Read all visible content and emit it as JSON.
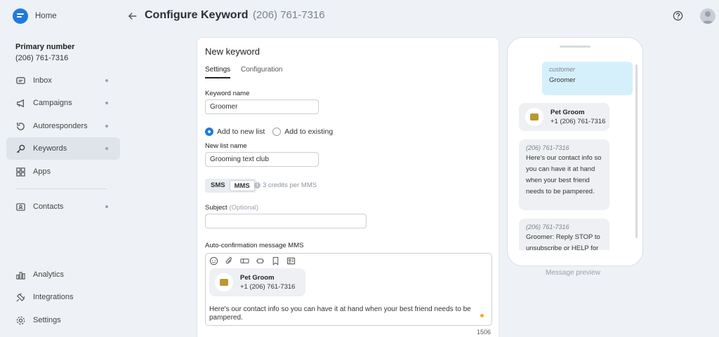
{
  "sidebar": {
    "home_label": "Home",
    "primary_title": "Primary number",
    "primary_number": "(206) 761-7316",
    "items": [
      {
        "label": "Inbox"
      },
      {
        "label": "Campaigns"
      },
      {
        "label": "Autoresponders"
      },
      {
        "label": "Keywords"
      },
      {
        "label": "Apps"
      },
      {
        "label": "Contacts"
      },
      {
        "label": "Analytics"
      },
      {
        "label": "Integrations"
      },
      {
        "label": "Settings"
      }
    ]
  },
  "header": {
    "title": "Configure Keyword",
    "phone": "(206) 761-7316"
  },
  "form": {
    "card_title": "New keyword",
    "tabs": [
      {
        "label": "Settings"
      },
      {
        "label": "Configuration"
      }
    ],
    "keyword_label": "Keyword name",
    "keyword_value": "Groomer",
    "radio_new": "Add to new list",
    "radio_existing": "Add to existing",
    "list_label": "New list name",
    "list_value": "Grooming text club",
    "seg_sms": "SMS",
    "seg_mms": "MMS",
    "credits": "3 credits per MMS",
    "subject_label": "Subject",
    "subject_optional": "(Optional)",
    "subject_value": "",
    "auto_label": "Auto-confirmation message MMS",
    "card_name": "Pet Groom",
    "card_phone": "+1 (206) 761-7316",
    "message": "Here's our contact info so you can have it at hand when your best friend needs to be pampered.",
    "counter": "1506"
  },
  "preview": {
    "out_who": "customer",
    "out_text": "Groomer",
    "card_name": "Pet Groom",
    "card_phone": "+1 (206) 761-7316",
    "msg1_num": "(206) 761-7316",
    "msg1_text": "Here's our contact info so you can have it at hand when your best friend needs to be pampered.",
    "msg2_num": "(206) 761-7316",
    "msg2_text": "Groomer: Reply STOP to unsubscribe or HELP for",
    "label": "Message preview"
  },
  "colors": {
    "accent": "#1f7ae0",
    "bubble_out": "#d6f0fb",
    "bubble_in": "#eef0f3"
  }
}
